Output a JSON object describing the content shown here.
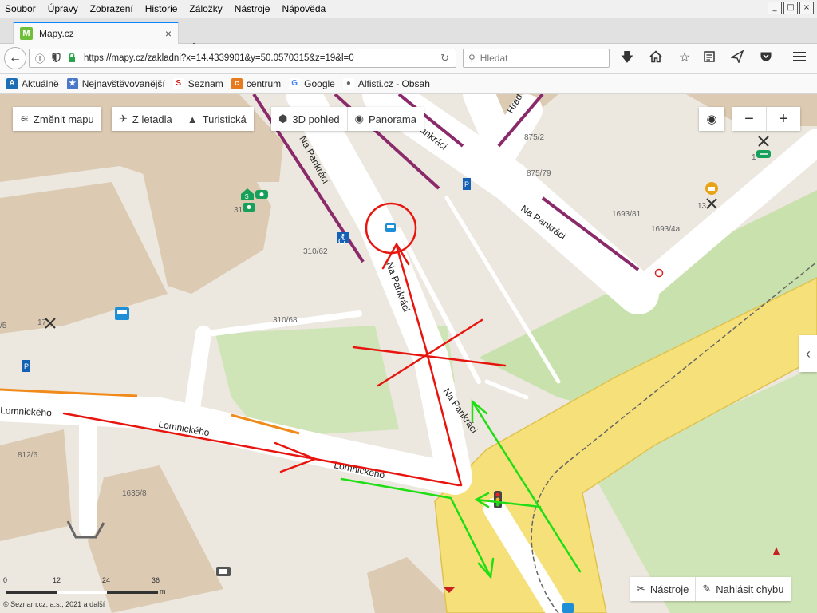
{
  "menu": [
    "Soubor",
    "Úpravy",
    "Zobrazení",
    "Historie",
    "Záložky",
    "Nástroje",
    "Nápověda"
  ],
  "window_controls": [
    "_",
    "□",
    "×"
  ],
  "tab": {
    "title": "Mapy.cz",
    "favicon": "M",
    "close": "×"
  },
  "new_tab": "+",
  "navbar": {
    "back": "←",
    "url": "https://mapy.cz/zakladni?x=14.4339901&y=50.0570315&z=19&l=0",
    "search_placeholder": "Hledat"
  },
  "bookmarks": [
    {
      "label": "Aktuálně",
      "icon": "A",
      "color": "#1c6fb5"
    },
    {
      "label": "Nejnavštěvovanější",
      "icon": "★",
      "color": "#4a78c8"
    },
    {
      "label": "Seznam",
      "icon": "S",
      "color": "#cc1b1b"
    },
    {
      "label": "centrum",
      "icon": "c",
      "color": "#e67a1c"
    },
    {
      "label": "Google",
      "icon": "G",
      "color": "#4285f4"
    },
    {
      "label": "Alfisti.cz - Obsah",
      "icon": "●",
      "color": "#666666"
    }
  ],
  "map_controls": {
    "change_map": "Změnit mapu",
    "aerial": "Z letadla",
    "tourist": "Turistická",
    "view3d": "3D pohled",
    "panorama": "Panorama",
    "zoom_out": "−",
    "zoom_in": "+",
    "collapse": "‹",
    "tools": "Nástroje",
    "report": "Nahlásit chybu"
  },
  "scale": {
    "ticks": [
      "0",
      "12",
      "24",
      "36"
    ],
    "unit": "m"
  },
  "copyright": "© Seznam.cz, a.s., 2021 a další",
  "streets": {
    "pankraci_top_left": "Na Pankráci",
    "pankraci_top_right": "Na Pankráci",
    "pankraci_right": "Na Pankráci",
    "pankraci_center": "Na Pankráci",
    "pankraci_lower": "Na Pankráci",
    "lomnickeho_left": "Lomnického",
    "lomnickeho_center": "Lomnického",
    "lomnickeho_lower": "Lomnického",
    "hrad": "Hrad"
  },
  "house_numbers": [
    "875/2",
    "875/79",
    "1693/81",
    "1693/4a",
    "310/62",
    "310/68",
    "812/6",
    "1635/8",
    "31",
    "17",
    "/5",
    "1",
    "13"
  ],
  "colors": {
    "annotation_red": "#e8150f",
    "annotation_green": "#1fde14",
    "main_road": "#f6e07a",
    "park": "#cfe6b5",
    "building": "#dcc9b0"
  },
  "icons": [
    "bus-stop-icon",
    "parking-icon",
    "wheelchair-icon",
    "bank-icon",
    "tram-icon",
    "tools-icon",
    "traffic-light-icon",
    "cafe-icon",
    "restaurant-icon",
    "target-icon"
  ]
}
